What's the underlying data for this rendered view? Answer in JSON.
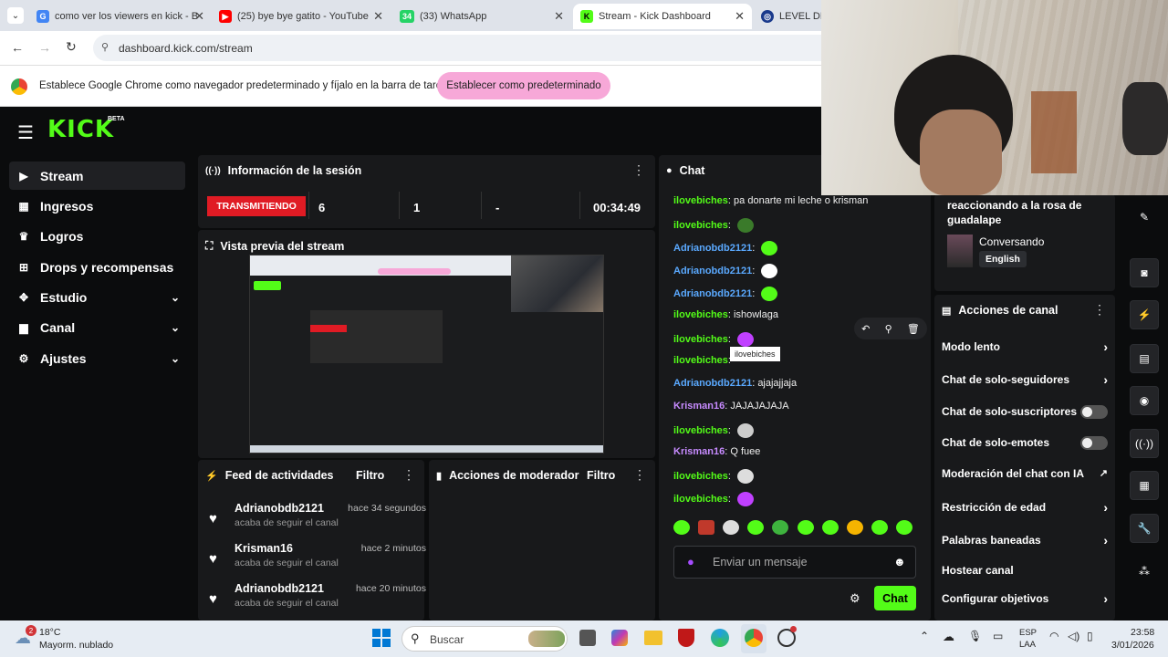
{
  "browser": {
    "tabs": [
      {
        "title": "como ver los viewers en kick - B",
        "fav_color": "#4285f4",
        "fav": "G"
      },
      {
        "title": "(25) bye bye gatito - YouTube",
        "fav_color": "#ff0000",
        "fav": "▶"
      },
      {
        "title": "(33) WhatsApp",
        "fav_color": "#25d366",
        "fav": "34"
      },
      {
        "title": "Stream - Kick Dashboard",
        "fav_color": "#53fc18",
        "fav": "K"
      },
      {
        "title": "LEVEL DEV",
        "fav_color": "#1a3a8c",
        "fav": "◎"
      }
    ],
    "url": "dashboard.kick.com/stream",
    "infobar_text": "Establece Google Chrome como navegador predeterminado y fíjalo en la barra de tareas",
    "infobar_button": "Establecer como predeterminado"
  },
  "app": {
    "logo": "KICK",
    "logo_badge": "BETA",
    "sidebar": [
      {
        "label": "Stream",
        "icon": "stream-icon",
        "glyph": "▶",
        "chevron": false
      },
      {
        "label": "Ingresos",
        "icon": "income-icon",
        "glyph": "▦",
        "chevron": false
      },
      {
        "label": "Logros",
        "icon": "trophy-icon",
        "glyph": "♛",
        "chevron": false
      },
      {
        "label": "Drops y recompensas",
        "icon": "drops-icon",
        "glyph": "⊞",
        "chevron": false
      },
      {
        "label": "Estudio",
        "icon": "studio-icon",
        "glyph": "✥",
        "chevron": true
      },
      {
        "label": "Canal",
        "icon": "channel-icon",
        "glyph": "▆",
        "chevron": true
      },
      {
        "label": "Ajustes",
        "icon": "settings-icon",
        "glyph": "⚙",
        "chevron": true
      }
    ],
    "session": {
      "title": "Información de la sesión",
      "live_badge": "TRANSMITIENDO",
      "stat1": "6",
      "stat2": "1",
      "stat3": "-",
      "duration": "00:34:49"
    },
    "preview": {
      "title": "Vista previa del stream"
    },
    "feed": {
      "title": "Feed de actividades",
      "filter": "Filtro",
      "items": [
        {
          "name": "Adrianobdb2121",
          "time": "hace 34 segundos",
          "action": "acaba de seguir el canal"
        },
        {
          "name": "Krisman16",
          "time": "hace 2 minutos",
          "action": "acaba de seguir el canal"
        },
        {
          "name": "Adrianobdb2121",
          "time": "hace 20 minutos",
          "action": "acaba de seguir el canal"
        }
      ]
    },
    "mod": {
      "title": "Acciones de moderador",
      "filter": "Filtro"
    },
    "chat": {
      "title": "Chat",
      "messages": [
        {
          "user": "ilovebiches",
          "color": "green",
          "text": "pa donarte mi leche o krisman",
          "emote": ""
        },
        {
          "user": "ilovebiches",
          "color": "green",
          "text": "",
          "emote": "#3a7a2a"
        },
        {
          "user": "Adrianobdb2121",
          "color": "blue",
          "text": "",
          "emote": "#53fc18"
        },
        {
          "user": "Adrianobdb2121",
          "color": "blue",
          "text": "",
          "emote": "#ffffff"
        },
        {
          "user": "Adrianobdb2121",
          "color": "blue",
          "text": "",
          "emote": "#53fc18"
        },
        {
          "user": "ilovebiches",
          "color": "green",
          "text": "ishowlaga",
          "emote": ""
        },
        {
          "user": "ilovebiches",
          "color": "green",
          "text": "",
          "emote": "#c040ff"
        },
        {
          "user": "ilovebiches",
          "color": "green",
          "text": "",
          "emote": ""
        },
        {
          "user": "Adrianobdb2121",
          "color": "blue",
          "text": "ajajajjaja",
          "emote": ""
        },
        {
          "user": "Krisman16",
          "color": "purple",
          "text": "JAJAJAJAJA",
          "emote": ""
        },
        {
          "user": "ilovebiches",
          "color": "green",
          "text": "",
          "emote": "#cccccc"
        },
        {
          "user": "Krisman16",
          "color": "purple",
          "text": "Q fuee",
          "emote": ""
        },
        {
          "user": "ilovebiches",
          "color": "green",
          "text": "",
          "emote": "#dddddd"
        },
        {
          "user": "ilovebiches",
          "color": "green",
          "text": "",
          "emote": "#c040ff"
        }
      ],
      "tooltip": "ilovebiches",
      "input_placeholder": "Enviar un mensaje",
      "send_label": "Chat"
    },
    "stream_info": {
      "title_text": "reaccionando a la rosa de guadalape",
      "category": "Conversando",
      "language": "English"
    },
    "channel_actions": {
      "title": "Acciones de canal",
      "items": [
        {
          "label": "Modo lento",
          "control": "chevron"
        },
        {
          "label": "Chat de solo-seguidores",
          "control": "chevron"
        },
        {
          "label": "Chat de solo-suscriptores",
          "control": "toggle"
        },
        {
          "label": "Chat de solo-emotes",
          "control": "toggle"
        },
        {
          "label": "Moderación del chat con IA",
          "control": "external"
        },
        {
          "label": "Restricción de edad",
          "control": "chevron"
        },
        {
          "label": "Palabras baneadas",
          "control": "chevron"
        },
        {
          "label": "Hostear canal",
          "control": "none"
        },
        {
          "label": "Configurar objetivos",
          "control": "chevron"
        }
      ]
    }
  },
  "taskbar": {
    "weather_temp": "18°C",
    "weather_desc": "Mayorm. nublado",
    "weather_badge": "2",
    "search_placeholder": "Buscar",
    "lang1": "ESP",
    "lang2": "LAA",
    "time": "23:58",
    "date": "3/01/2026"
  },
  "colors": {
    "kick_green": "#53fc18",
    "live_red": "#e01b24",
    "infobar_btn": "#f7a8d8"
  }
}
